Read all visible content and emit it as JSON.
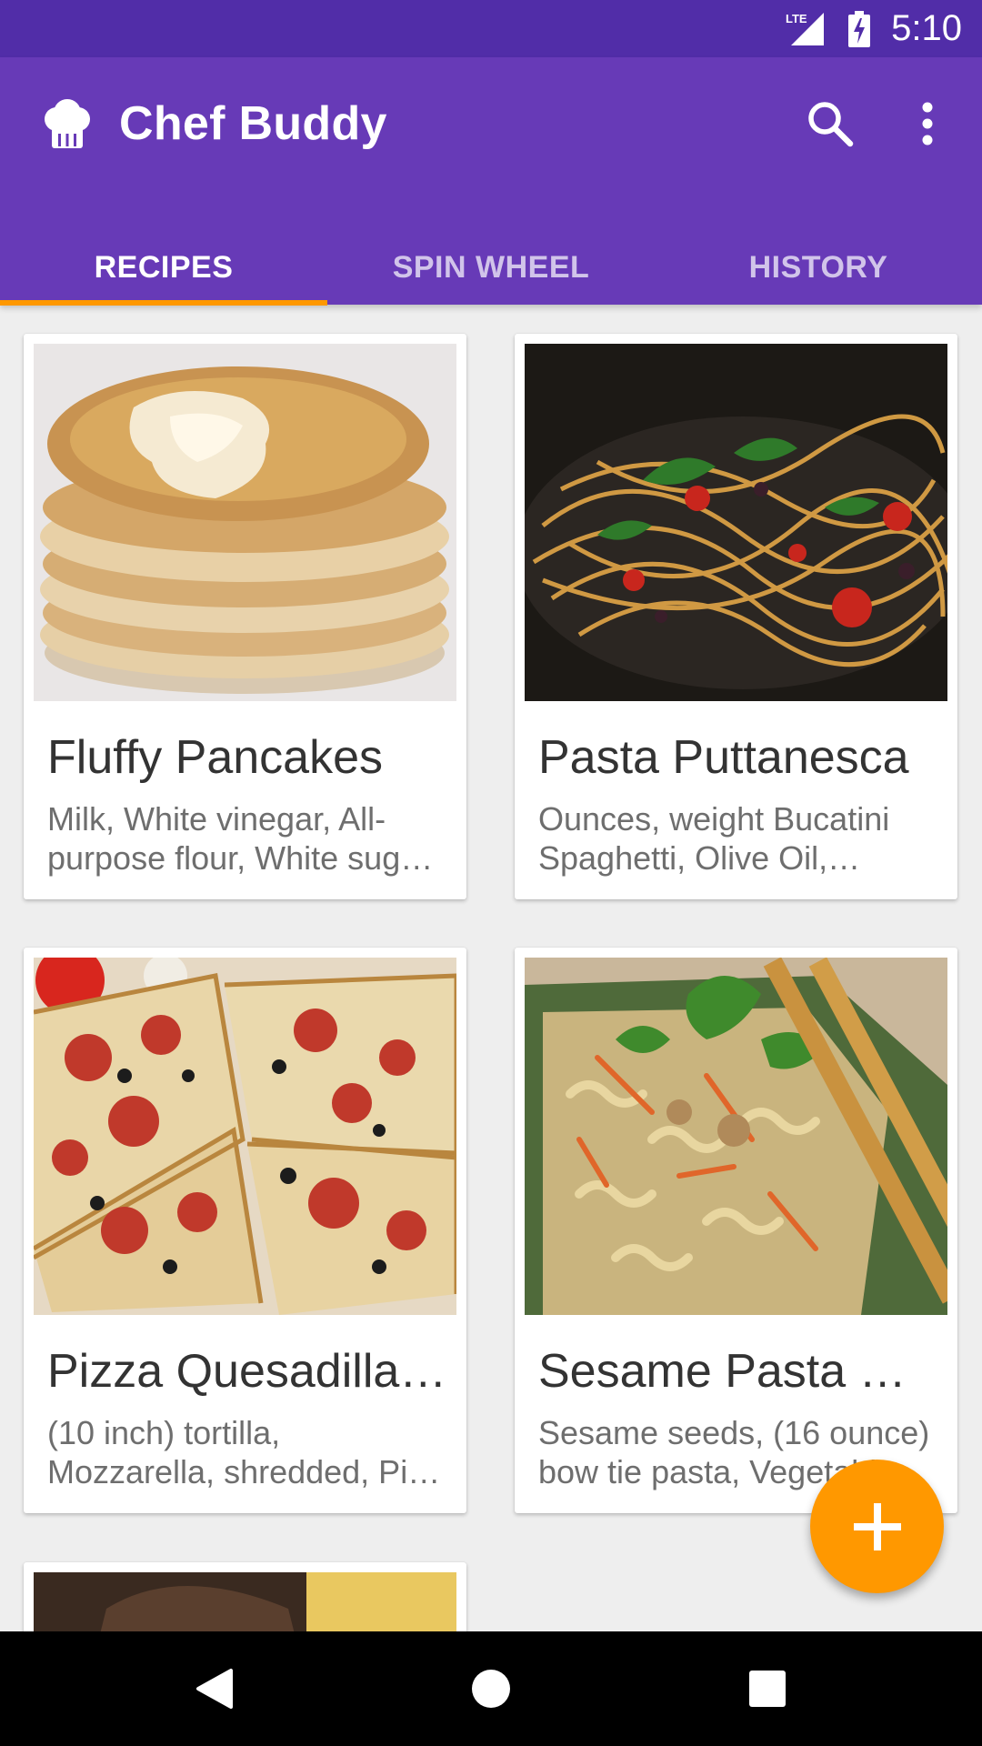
{
  "status_bar": {
    "network": "LTE",
    "time": "5:10"
  },
  "app_bar": {
    "title": "Chef Buddy",
    "logo_icon": "chef-hat-icon",
    "actions": [
      "search-icon",
      "more-vert-icon"
    ],
    "color": "#673ab7",
    "status_color": "#512da8"
  },
  "tabs": [
    {
      "label": "RECIPES",
      "active": true
    },
    {
      "label": "SPIN WHEEL",
      "active": false
    },
    {
      "label": "HISTORY",
      "active": false
    }
  ],
  "accent_color": "#ff9800",
  "recipes": [
    {
      "title": "Fluffy Pancakes",
      "description": "Milk, White vinegar, All-purpose flour, White sug…"
    },
    {
      "title": "Pasta Puttanesca",
      "description": "Ounces, weight Bucatini Spaghetti, Olive Oil, Whol…"
    },
    {
      "title": "Pizza Quesadilla…",
      "description": "(10 inch) tortilla, Mozzarella, shredded, Pi…"
    },
    {
      "title": "Sesame Pasta C…",
      "description": "Sesame seeds, (16 ounce) bow tie pasta, Vegetabl…"
    }
  ],
  "fab": {
    "icon": "add-icon"
  },
  "nav_bar": {
    "buttons": [
      "back-icon",
      "home-icon",
      "recents-icon"
    ]
  }
}
